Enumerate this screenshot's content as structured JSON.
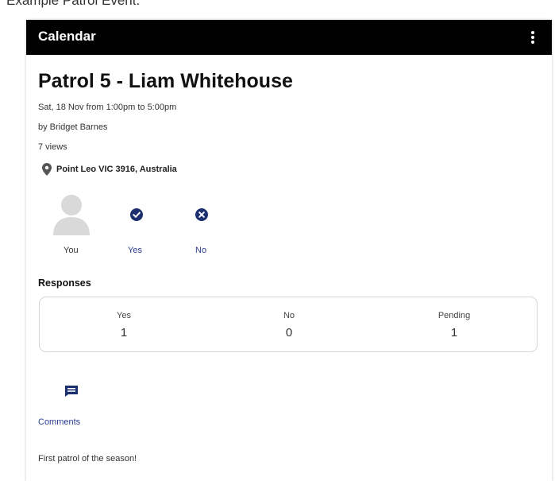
{
  "caption": "Example Patrol Event.",
  "appbar": {
    "title": "Calendar",
    "menu_icon": "more-vert-icon"
  },
  "event": {
    "title": "Patrol 5 - Liam Whitehouse",
    "datetime": "Sat, 18 Nov from 1:00pm to 5:00pm",
    "author": "by Bridget Barnes",
    "views": "7 views",
    "location": "Point Leo VIC 3916, Australia"
  },
  "rsvp": {
    "you_label": "You",
    "yes_label": "Yes",
    "no_label": "No"
  },
  "responses": {
    "heading": "Responses",
    "columns": [
      {
        "label": "Yes",
        "value": "1"
      },
      {
        "label": "No",
        "value": "0"
      },
      {
        "label": "Pending",
        "value": "1"
      }
    ]
  },
  "comments": {
    "label": "Comments",
    "icon": "comment-icon"
  },
  "description": "First patrol of the season!",
  "colors": {
    "appbar": "#000000",
    "accent": "#1c2f6e",
    "link": "#2c3e8f"
  }
}
